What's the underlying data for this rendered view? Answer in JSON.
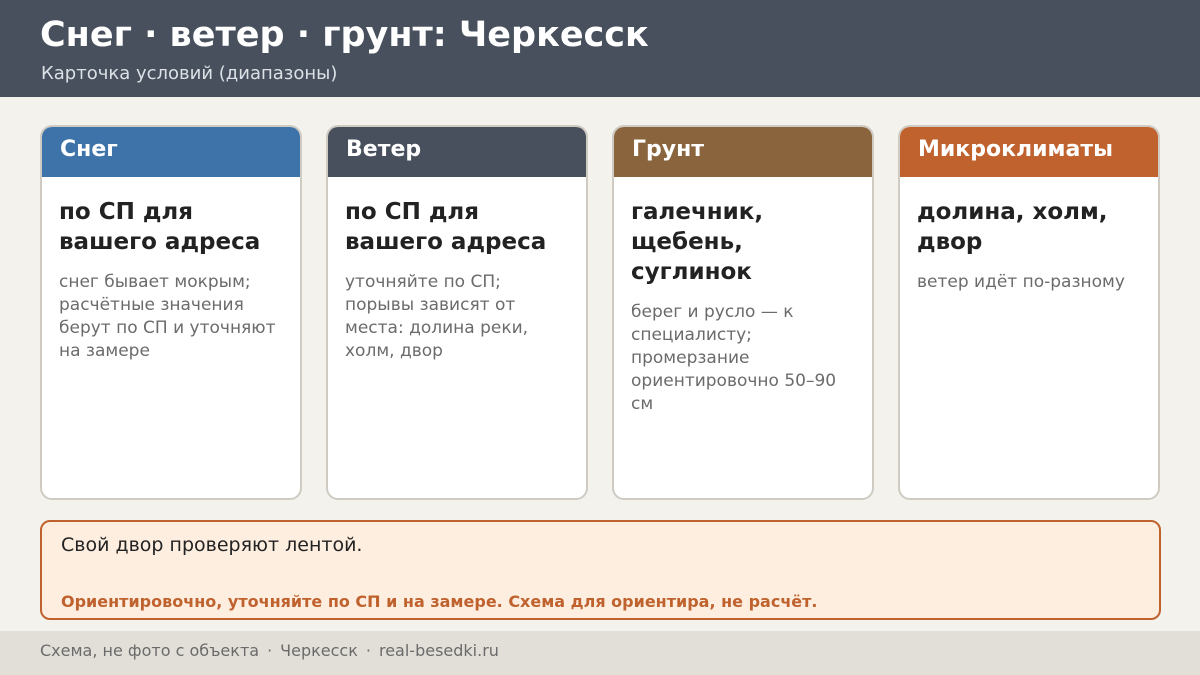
{
  "header": {
    "title": "Снег · ветер · грунт: Черкесск",
    "subtitle": "Карточка условий (диапазоны)"
  },
  "cards": [
    {
      "heading": "Снег",
      "color": "#3d73a8",
      "main": "по СП для вашего адреса",
      "text": "снег бывает мокрым; расчётные значения берут по СП и уточняют на замере"
    },
    {
      "heading": "Ветер",
      "color": "#47505c",
      "main": "по СП для вашего адреса",
      "text": "уточняйте по СП; порывы зависят от места: долина реки, холм, двор"
    },
    {
      "heading": "Грунт",
      "color": "#8a643d",
      "main": "галечник, щебень, суглинок",
      "text": "берег и русло — к специалисту; промерзание ориентировочно 50–90 см"
    },
    {
      "heading": "Микроклиматы",
      "color": "#c0622e",
      "main": "долина, холм, двор",
      "text": "ветер идёт по-разному"
    }
  ],
  "note": {
    "text": "Свой двор проверяют лентой.",
    "warning": "Ориентировочно, уточняйте по СП и на замере. Схема для ориентира, не расчёт."
  },
  "footer": {
    "items": [
      "Схема, не фото с объекта",
      "Черкесск",
      "real-besedki.ru"
    ],
    "separator": "·"
  }
}
